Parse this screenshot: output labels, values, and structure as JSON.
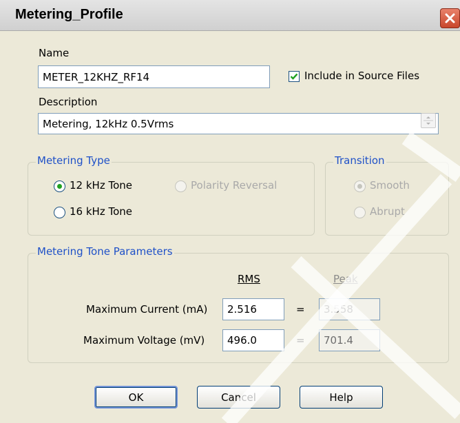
{
  "window": {
    "title": "Metering_Profile"
  },
  "name": {
    "label": "Name",
    "value": "METER_12KHZ_RF14"
  },
  "include_source": {
    "label": "Include in Source Files",
    "checked": true
  },
  "description": {
    "label": "Description",
    "value": "Metering, 12kHz 0.5Vrms"
  },
  "metering_type": {
    "legend": "Metering Type",
    "options": [
      {
        "label": "12 kHz Tone",
        "selected": true,
        "enabled": true
      },
      {
        "label": "Polarity Reversal",
        "selected": false,
        "enabled": false
      },
      {
        "label": "16 kHz Tone",
        "selected": false,
        "enabled": true
      }
    ]
  },
  "transition": {
    "legend": "Transition",
    "options": [
      {
        "label": "Smooth",
        "selected": true,
        "enabled": false
      },
      {
        "label": "Abrupt",
        "selected": false,
        "enabled": false
      }
    ]
  },
  "tone_params": {
    "legend": "Metering Tone Parameters",
    "col_rms": "RMS",
    "col_peak": "Peak",
    "rows": [
      {
        "label": "Maximum Current (mA)",
        "rms": "2.516",
        "eq": "=",
        "peak": "3.558"
      },
      {
        "label": "Maximum Voltage (mV)",
        "rms": "496.0",
        "eq": "=",
        "peak": "701.4"
      }
    ]
  },
  "buttons": {
    "ok": "OK",
    "cancel": "Cancel",
    "help": "Help"
  },
  "colors": {
    "accent": "#1f51c8",
    "selected_radio": "#21a121",
    "close": "#c8462b",
    "face": "#ece9d8"
  },
  "icons": {
    "close": "close-icon",
    "check": "checkmark-icon",
    "spin": "spin-arrows-icon"
  }
}
